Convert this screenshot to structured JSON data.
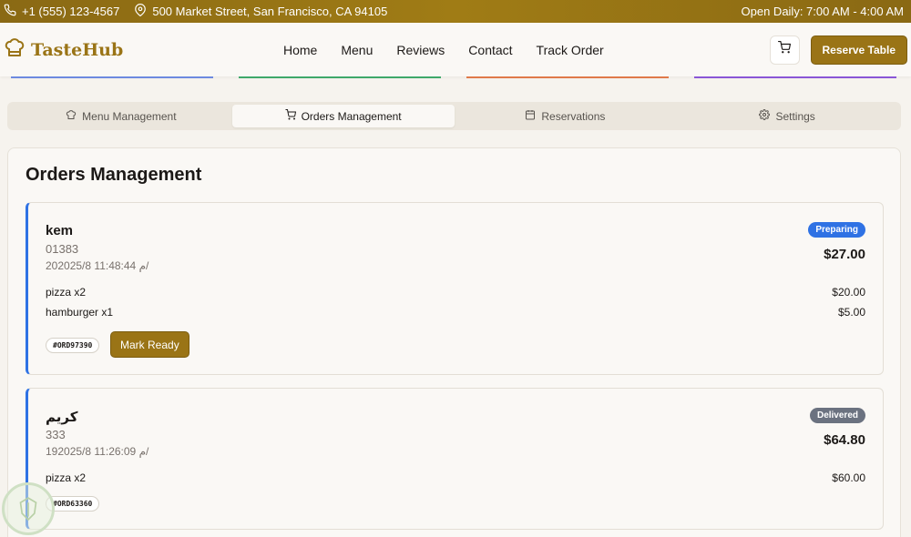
{
  "topbar": {
    "phone": "+1 (555) 123-4567",
    "address": "500 Market Street, San Francisco, CA 94105",
    "hours": "Open Daily: 7:00 AM - 4:00 AM"
  },
  "header": {
    "brand": "TasteHub",
    "nav": [
      "Home",
      "Menu",
      "Reviews",
      "Contact",
      "Track Order"
    ],
    "reserve_label": "Reserve Table"
  },
  "tabs": [
    {
      "label": "Menu Management",
      "icon": "chef-hat-icon",
      "active": false
    },
    {
      "label": "Orders Management",
      "icon": "cart-icon",
      "active": true
    },
    {
      "label": "Reservations",
      "icon": "calendar-icon",
      "active": false
    },
    {
      "label": "Settings",
      "icon": "gear-icon",
      "active": false
    }
  ],
  "panel": {
    "title": "Orders Management"
  },
  "orders": [
    {
      "name": "kem",
      "phone": "01383",
      "date": "20م 11:48:44 2025/8/",
      "status": "Preparing",
      "status_color": "#2f72e4",
      "total": "$27.00",
      "items": [
        {
          "name": "pizza x2",
          "price": "$20.00"
        },
        {
          "name": "hamburger x1",
          "price": "$5.00"
        }
      ],
      "order_id": "#ORD97390",
      "action": "Mark Ready"
    },
    {
      "name": "كريم",
      "phone": "333",
      "date": "19م 11:26:09 2025/8/",
      "status": "Delivered",
      "status_color": "#6b7280",
      "total": "$64.80",
      "items": [
        {
          "name": "pizza x2",
          "price": "$60.00"
        }
      ],
      "order_id": "#ORD63360"
    }
  ],
  "colors": {
    "brand": "#9a7416",
    "topbar": "#8a6914",
    "accent_blue": "#2f72e4"
  }
}
